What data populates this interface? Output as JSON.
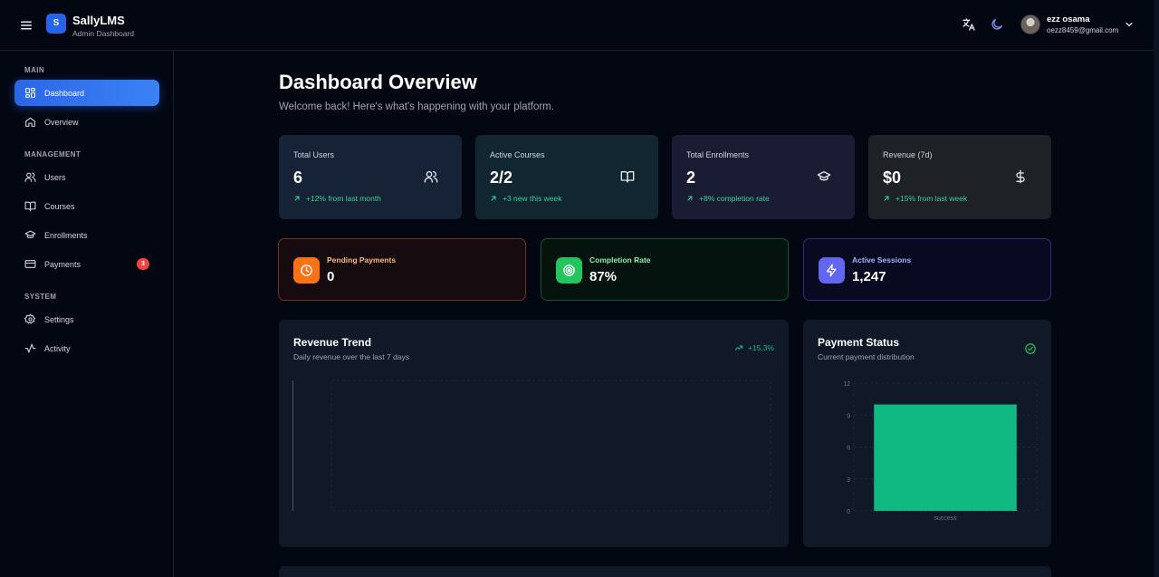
{
  "header": {
    "logo_letter": "S",
    "brand": "SallyLMS",
    "subtitle": "Admin Dashboard",
    "user": {
      "name": "ezz osama",
      "email": "oezz8459@gmail.com"
    }
  },
  "sidebar": {
    "sections": [
      {
        "label": "MAIN"
      },
      {
        "label": "MANAGEMENT"
      },
      {
        "label": "SYSTEM"
      }
    ],
    "items": [
      {
        "label": "Dashboard",
        "icon": "dashboard-icon",
        "active": true
      },
      {
        "label": "Overview",
        "icon": "home-icon"
      },
      {
        "label": "Users",
        "icon": "users-icon"
      },
      {
        "label": "Courses",
        "icon": "book-icon"
      },
      {
        "label": "Enrollments",
        "icon": "graduation-cap-icon"
      },
      {
        "label": "Payments",
        "icon": "credit-card-icon",
        "badge": "3"
      },
      {
        "label": "Settings",
        "icon": "gear-icon"
      },
      {
        "label": "Activity",
        "icon": "activity-icon"
      }
    ]
  },
  "main": {
    "title": "Dashboard Overview",
    "subtitle": "Welcome back! Here's what's happening with your platform.",
    "stats": [
      {
        "title": "Total Users",
        "value": "6",
        "trend": "+12% from last month",
        "icon": "users-icon"
      },
      {
        "title": "Active Courses",
        "value": "2/2",
        "trend": "+3 new this week",
        "icon": "book-icon"
      },
      {
        "title": "Total Enrollments",
        "value": "2",
        "trend": "+8% completion rate",
        "icon": "graduation-cap-icon"
      },
      {
        "title": "Revenue (7d)",
        "value": "$0",
        "trend": "+15% from last week",
        "icon": "dollar-icon"
      }
    ],
    "mini_stats": [
      {
        "title": "Pending Payments",
        "value": "0",
        "icon": "clock-icon",
        "color": "#f97316"
      },
      {
        "title": "Completion Rate",
        "value": "87%",
        "icon": "target-icon",
        "color": "#22c55e"
      },
      {
        "title": "Active Sessions",
        "value": "1,247",
        "icon": "bolt-icon",
        "color": "#6366f1"
      }
    ],
    "revenue_panel": {
      "title": "Revenue Trend",
      "subtitle": "Daily revenue over the last 7 days",
      "trend": "+15.3%"
    },
    "payment_panel": {
      "title": "Payment Status",
      "subtitle": "Current payment distribution"
    }
  },
  "chart_data": [
    {
      "type": "line",
      "title": "Revenue Trend",
      "subtitle": "Daily revenue over the last 7 days",
      "series": [],
      "grid": true
    },
    {
      "type": "bar",
      "title": "Payment Status",
      "subtitle": "Current payment distribution",
      "categories": [
        "success"
      ],
      "values": [
        10
      ],
      "ylim": [
        0,
        12
      ],
      "yticks": [
        0,
        3,
        6,
        9,
        12
      ],
      "colors": [
        "#10b981"
      ],
      "grid": true
    }
  ]
}
